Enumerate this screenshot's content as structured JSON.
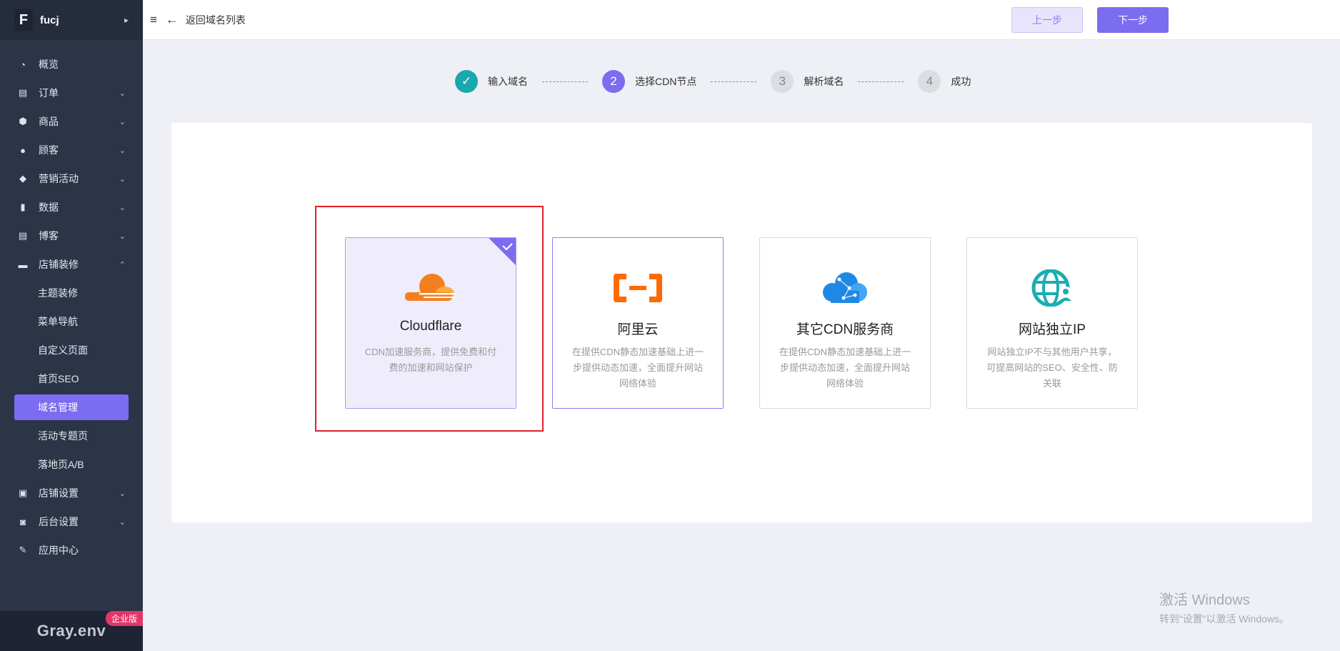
{
  "brand": {
    "logo": "F",
    "name": "fucj",
    "arrow": "▸"
  },
  "sidebar": {
    "items": [
      {
        "label": "概览",
        "icon": "dashboard-icon",
        "glyph": "◔",
        "chevron": ""
      },
      {
        "label": "订单",
        "icon": "order-icon",
        "glyph": "▤",
        "chevron": "⌄"
      },
      {
        "label": "商品",
        "icon": "product-icon",
        "glyph": "⬢",
        "chevron": "⌄"
      },
      {
        "label": "顾客",
        "icon": "customer-icon",
        "glyph": "●",
        "chevron": "⌄"
      },
      {
        "label": "营销活动",
        "icon": "tag-icon",
        "glyph": "◆",
        "chevron": "⌄"
      },
      {
        "label": "数据",
        "icon": "bar-chart-icon",
        "glyph": "▮",
        "chevron": "⌄"
      },
      {
        "label": "博客",
        "icon": "blog-icon",
        "glyph": "▤",
        "chevron": "⌄"
      },
      {
        "label": "店铺装修",
        "icon": "paint-roller-icon",
        "glyph": "▬",
        "chevron": "⌃"
      }
    ],
    "sub_items": [
      "主题装修",
      "菜单导航",
      "自定义页面",
      "首页SEO",
      "域名管理",
      "活动专题页",
      "落地页A/B"
    ],
    "active_sub": "域名管理",
    "items_after": [
      {
        "label": "店铺设置",
        "icon": "store-icon",
        "glyph": "▣",
        "chevron": "⌄"
      },
      {
        "label": "后台设置",
        "icon": "settings-icon",
        "glyph": "◙",
        "chevron": "⌄"
      },
      {
        "label": "应用中心",
        "icon": "wrench-icon",
        "glyph": "✎",
        "chevron": ""
      }
    ],
    "footer_env": "Gray.env",
    "footer_badge": "企业版"
  },
  "header": {
    "menu_icon": "≡",
    "back_icon": "←",
    "back_text": "返回域名列表",
    "prev_button": "上一步",
    "next_button": "下一步"
  },
  "steps": [
    {
      "num": "✓",
      "label": "输入域名",
      "state": "done"
    },
    {
      "num": "2",
      "label": "选择CDN节点",
      "state": "current"
    },
    {
      "num": "3",
      "label": "解析域名",
      "state": "todo"
    },
    {
      "num": "4",
      "label": "成功",
      "state": "todo"
    }
  ],
  "options": [
    {
      "title": "Cloudflare",
      "desc": "CDN加速服务商，提供免费和付费的加速和网站保护",
      "icon": "cloudflare-icon",
      "selected": true
    },
    {
      "title": "阿里云",
      "desc": "在提供CDN静态加速基础上进一步提供动态加速，全面提升网站网络体验",
      "icon": "aliyun-icon",
      "selected": false
    },
    {
      "title": "其它CDN服务商",
      "desc": "在提供CDN静态加速基础上进一步提供动态加速，全面提升网站网络体验",
      "icon": "cloud-network-icon",
      "selected": false
    },
    {
      "title": "网站独立IP",
      "desc": "网站独立IP不与其他用户共享，可提高网站的SEO、安全性、防关联",
      "icon": "globe-user-icon",
      "selected": false
    }
  ],
  "colors": {
    "accent": "#7b6cf0",
    "done": "#19a8ae",
    "sidebar": "#2c3447",
    "highlight": "#e0202a"
  },
  "windows": {
    "line1": "激活 Windows",
    "line2": "转到“设置”以激活 Windows。"
  }
}
